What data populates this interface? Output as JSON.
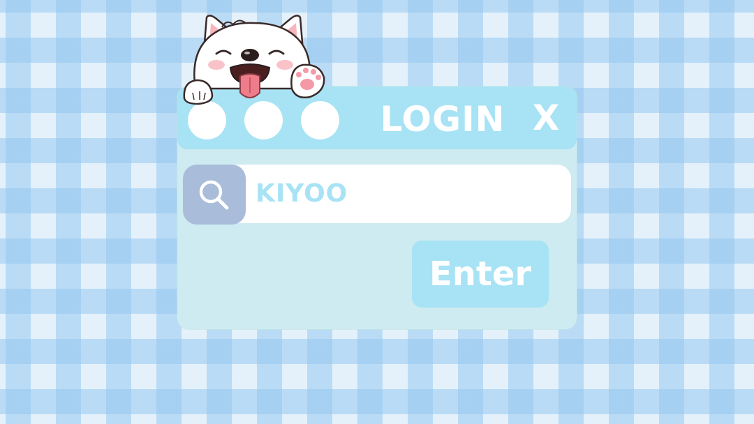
{
  "window": {
    "title": "LOGIN",
    "close_label": "X",
    "traffic_lights": [
      "circle",
      "circle",
      "circle"
    ]
  },
  "search": {
    "icon": "search-icon",
    "value": "KIYOO"
  },
  "actions": {
    "enter_label": "Enter"
  },
  "decor": {
    "mascot": "samoyed-dog-illustration",
    "background": "blue-gingham-pattern"
  },
  "colors": {
    "titlebar": "#a7e3f4",
    "panel": "#cdebf0",
    "search_icon_bg": "#a9bcd9",
    "text_accent": "#a7e3f4",
    "gingham": "#96c8f0"
  }
}
